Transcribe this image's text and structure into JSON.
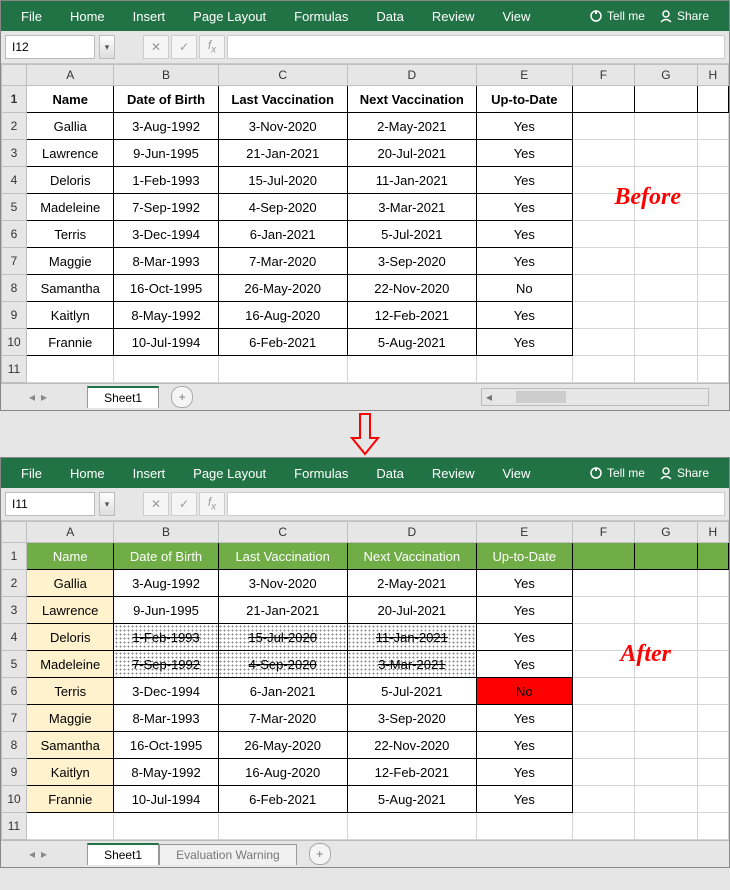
{
  "ribbon": {
    "tabs": [
      "File",
      "Home",
      "Insert",
      "Page Layout",
      "Formulas",
      "Data",
      "Review",
      "View"
    ],
    "tellme": "Tell me",
    "share": "Share"
  },
  "before": {
    "namebox": "I12",
    "annotation": "Before",
    "columns": [
      "A",
      "B",
      "C",
      "D",
      "E",
      "F",
      "G",
      "H"
    ],
    "headers": [
      "Name",
      "Date of Birth",
      "Last Vaccination",
      "Next Vaccination",
      "Up-to-Date"
    ],
    "rows": [
      [
        "Gallia",
        "3-Aug-1992",
        "3-Nov-2020",
        "2-May-2021",
        "Yes"
      ],
      [
        "Lawrence",
        "9-Jun-1995",
        "21-Jan-2021",
        "20-Jul-2021",
        "Yes"
      ],
      [
        "Deloris",
        "1-Feb-1993",
        "15-Jul-2020",
        "11-Jan-2021",
        "Yes"
      ],
      [
        "Madeleine",
        "7-Sep-1992",
        "4-Sep-2020",
        "3-Mar-2021",
        "Yes"
      ],
      [
        "Terris",
        "3-Dec-1994",
        "6-Jan-2021",
        "5-Jul-2021",
        "Yes"
      ],
      [
        "Maggie",
        "8-Mar-1993",
        "7-Mar-2020",
        "3-Sep-2020",
        "Yes"
      ],
      [
        "Samantha",
        "16-Oct-1995",
        "26-May-2020",
        "22-Nov-2020",
        "No"
      ],
      [
        "Kaitlyn",
        "8-May-1992",
        "16-Aug-2020",
        "12-Feb-2021",
        "Yes"
      ],
      [
        "Frannie",
        "10-Jul-1994",
        "6-Feb-2021",
        "5-Aug-2021",
        "Yes"
      ]
    ],
    "sheet": "Sheet1"
  },
  "after": {
    "namebox": "I11",
    "annotation": "After",
    "columns": [
      "A",
      "B",
      "C",
      "D",
      "E",
      "F",
      "G",
      "H"
    ],
    "headers": [
      "Name",
      "Date of Birth",
      "Last Vaccination",
      "Next Vaccination",
      "Up-to-Date"
    ],
    "rows": [
      {
        "c": [
          "Gallia",
          "3-Aug-1992",
          "3-Nov-2020",
          "2-May-2021",
          "Yes"
        ]
      },
      {
        "c": [
          "Lawrence",
          "9-Jun-1995",
          "21-Jan-2021",
          "20-Jul-2021",
          "Yes"
        ]
      },
      {
        "c": [
          "Deloris",
          "1-Feb-1993",
          "15-Jul-2020",
          "11-Jan-2021",
          "Yes"
        ],
        "strike": true
      },
      {
        "c": [
          "Madeleine",
          "7-Sep-1992",
          "4-Sep-2020",
          "3-Mar-2021",
          "Yes"
        ],
        "strike": true
      },
      {
        "c": [
          "Terris",
          "3-Dec-1994",
          "6-Jan-2021",
          "5-Jul-2021",
          "No"
        ],
        "red": true
      },
      {
        "c": [
          "Maggie",
          "8-Mar-1993",
          "7-Mar-2020",
          "3-Sep-2020",
          "Yes"
        ]
      },
      {
        "c": [
          "Samantha",
          "16-Oct-1995",
          "26-May-2020",
          "22-Nov-2020",
          "Yes"
        ]
      },
      {
        "c": [
          "Kaitlyn",
          "8-May-1992",
          "16-Aug-2020",
          "12-Feb-2021",
          "Yes"
        ]
      },
      {
        "c": [
          "Frannie",
          "10-Jul-1994",
          "6-Feb-2021",
          "5-Aug-2021",
          "Yes"
        ]
      }
    ],
    "sheet": "Sheet1",
    "warn": "Evaluation Warning"
  }
}
